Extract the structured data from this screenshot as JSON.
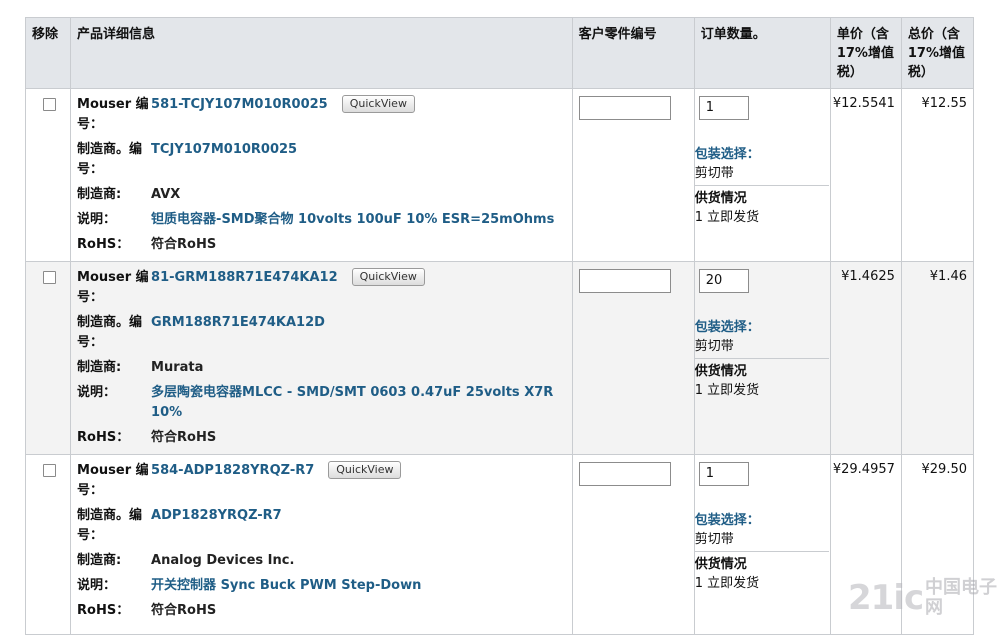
{
  "headers": {
    "remove": "移除",
    "info": "产品详细信息",
    "customer_part": "客户零件编号",
    "qty": "订单数量。",
    "unit_price": "单价（含17%增值税）",
    "total_price": "总价（含17%增值税）"
  },
  "labels": {
    "mouser_no": "Mouser 编号：",
    "mfr_no": "制造商。编号：",
    "mfr": "制造商:",
    "desc": "说明：",
    "rohs": "RoHS：",
    "quickview": "QuickView",
    "pkg": "包装选择：",
    "supply": "供货情况"
  },
  "items": [
    {
      "mouser_no": "581-TCJY107M010R0025",
      "mfr_no": "TCJY107M010R0025",
      "mfr": "AVX",
      "desc": "钽质电容器-SMD聚合物 10volts 100uF 10% ESR=25mOhms",
      "rohs": "符合RoHS",
      "customer_part": "",
      "qty": "1",
      "packaging": "剪切带",
      "supply_count": "1",
      "supply_text": "立即发货",
      "unit_price": "¥12.5541",
      "total_price": "¥12.55"
    },
    {
      "mouser_no": "81-GRM188R71E474KA12",
      "mfr_no": "GRM188R71E474KA12D",
      "mfr": "Murata",
      "desc": "多层陶瓷电容器MLCC - SMD/SMT 0603 0.47uF 25volts X7R 10%",
      "rohs": "符合RoHS",
      "customer_part": "",
      "qty": "20",
      "packaging": "剪切带",
      "supply_count": "1",
      "supply_text": "立即发货",
      "unit_price": "¥1.4625",
      "total_price": "¥1.46"
    },
    {
      "mouser_no": "584-ADP1828YRQZ-R7",
      "mfr_no": "ADP1828YRQZ-R7",
      "mfr": "Analog Devices Inc.",
      "desc": "开关控制器 Sync Buck PWM Step-Down",
      "rohs": "符合RoHS",
      "customer_part": "",
      "qty": "1",
      "packaging": "剪切带",
      "supply_count": "1",
      "supply_text": "立即发货",
      "unit_price": "¥29.4957",
      "total_price": "¥29.50"
    }
  ],
  "watermark": {
    "logo": "21ic",
    "site": "中国电子网"
  }
}
